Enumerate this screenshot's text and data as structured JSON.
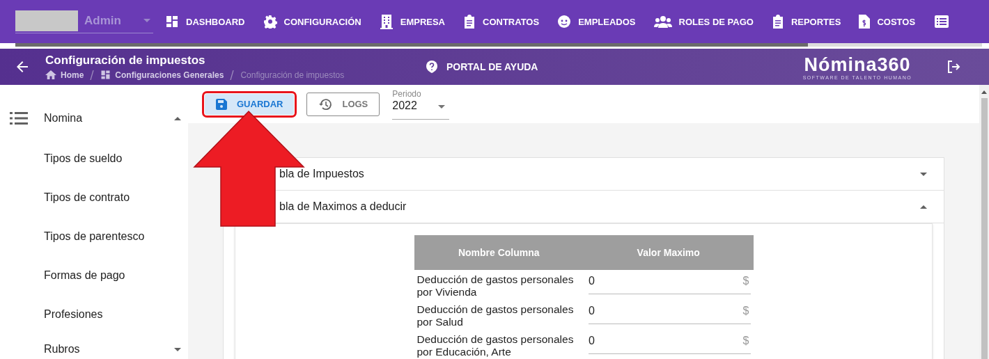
{
  "user_select": {
    "value": "Admin"
  },
  "nav": [
    {
      "label": "DASHBOARD"
    },
    {
      "label": "CONFIGURACIÓN"
    },
    {
      "label": "EMPRESA"
    },
    {
      "label": "CONTRATOS"
    },
    {
      "label": "EMPLEADOS"
    },
    {
      "label": "ROLES DE PAGO"
    },
    {
      "label": "REPORTES"
    },
    {
      "label": "COSTOS"
    }
  ],
  "loading": {
    "level": 0.82
  },
  "header": {
    "title": "Configuración de impuestos",
    "breadcrumbs": [
      {
        "label": "Home"
      },
      {
        "label": "Configuraciones Generales"
      },
      {
        "label": "Configuración de impuestos"
      }
    ],
    "help": "PORTAL DE AYUDA",
    "brand": "Nómina360",
    "tagline": "SOFTWARE DE TALENTO HUMANO"
  },
  "sidebar": {
    "items": [
      {
        "label": "Nomina",
        "expanded": true,
        "children": [
          {
            "label": "Tipos de sueldo"
          },
          {
            "label": "Tipos de contrato"
          },
          {
            "label": "Tipos de parentesco"
          },
          {
            "label": "Formas de pago"
          },
          {
            "label": "Profesiones"
          }
        ]
      },
      {
        "label": "Rubros",
        "expanded": false
      }
    ]
  },
  "toolbar": {
    "buttons": [
      {
        "label": "GUARDAR",
        "highlighted": true
      },
      {
        "label": "LOGS",
        "highlighted": false
      }
    ],
    "period": {
      "label": "Periodo",
      "value": "2022"
    }
  },
  "panels": [
    {
      "title": "bla de Impuestos",
      "expanded": false
    },
    {
      "title": "bla de Maximos a deducir",
      "expanded": true
    }
  ],
  "table": {
    "columns": [
      "Nombre Columna",
      "Valor Maximo"
    ],
    "rows": [
      {
        "name": "Deducción de gastos personales por Vivienda",
        "value": "0",
        "unit": "$"
      },
      {
        "name": "Deducción de gastos personales por Salud",
        "value": "0",
        "unit": "$"
      },
      {
        "name": "Deducción de gastos personales por Educación, Arte",
        "value": "0",
        "unit": "$"
      }
    ]
  }
}
